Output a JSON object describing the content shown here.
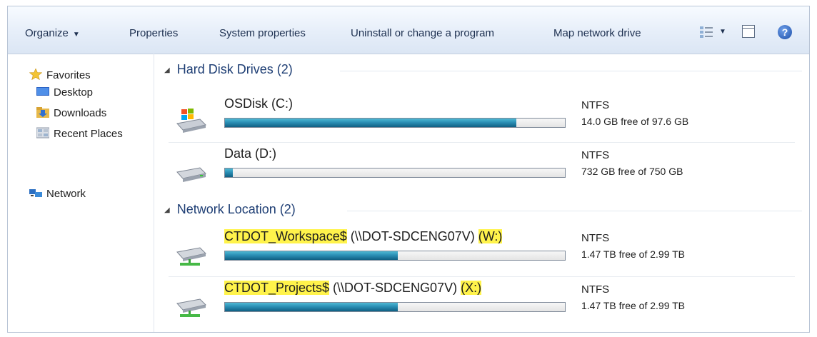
{
  "toolbar": {
    "organize": "Organize",
    "properties": "Properties",
    "system_properties": "System properties",
    "uninstall": "Uninstall or change a program",
    "map_network_drive": "Map network drive"
  },
  "nav": {
    "favorites": "Favorites",
    "desktop": "Desktop",
    "downloads": "Downloads",
    "recent_places": "Recent Places",
    "network": "Network"
  },
  "groups": {
    "hard_disk_drives": {
      "label": "Hard Disk Drives",
      "count": "(2)"
    },
    "network_location": {
      "label": "Network Location",
      "count": "(2)"
    }
  },
  "drives": [
    {
      "name": "OSDisk (C:)",
      "fs": "NTFS",
      "free_text": "14.0 GB free of 97.6 GB",
      "used_fraction": 0.857
    },
    {
      "name": "Data (D:)",
      "fs": "NTFS",
      "free_text": "732 GB free of 750 GB",
      "used_fraction": 0.024
    },
    {
      "name_highlight": "CTDOT_Workspace$",
      "name_path": " (\\\\DOT-SDCENG07V) ",
      "name_letter": "(W:)",
      "fs": "NTFS",
      "free_text": "1.47 TB free of 2.99 TB",
      "used_fraction": 0.508
    },
    {
      "name_highlight": "CTDOT_Projects$",
      "name_path": " (\\\\DOT-SDCENG07V) ",
      "name_letter": "(X:)",
      "fs": "NTFS",
      "free_text": "1.47 TB free of 2.99 TB",
      "used_fraction": 0.508
    }
  ],
  "colors": {
    "highlight": "#fff34b",
    "bar_fill": "#2b8fb5",
    "group_header": "#1e3e74"
  },
  "icons": [
    "favorites-star-icon",
    "desktop-icon",
    "downloads-icon",
    "recent-places-icon",
    "network-icon",
    "windows-drive-icon",
    "hard-drive-icon",
    "network-drive-icon",
    "views-icon",
    "preview-pane-icon",
    "help-icon"
  ]
}
